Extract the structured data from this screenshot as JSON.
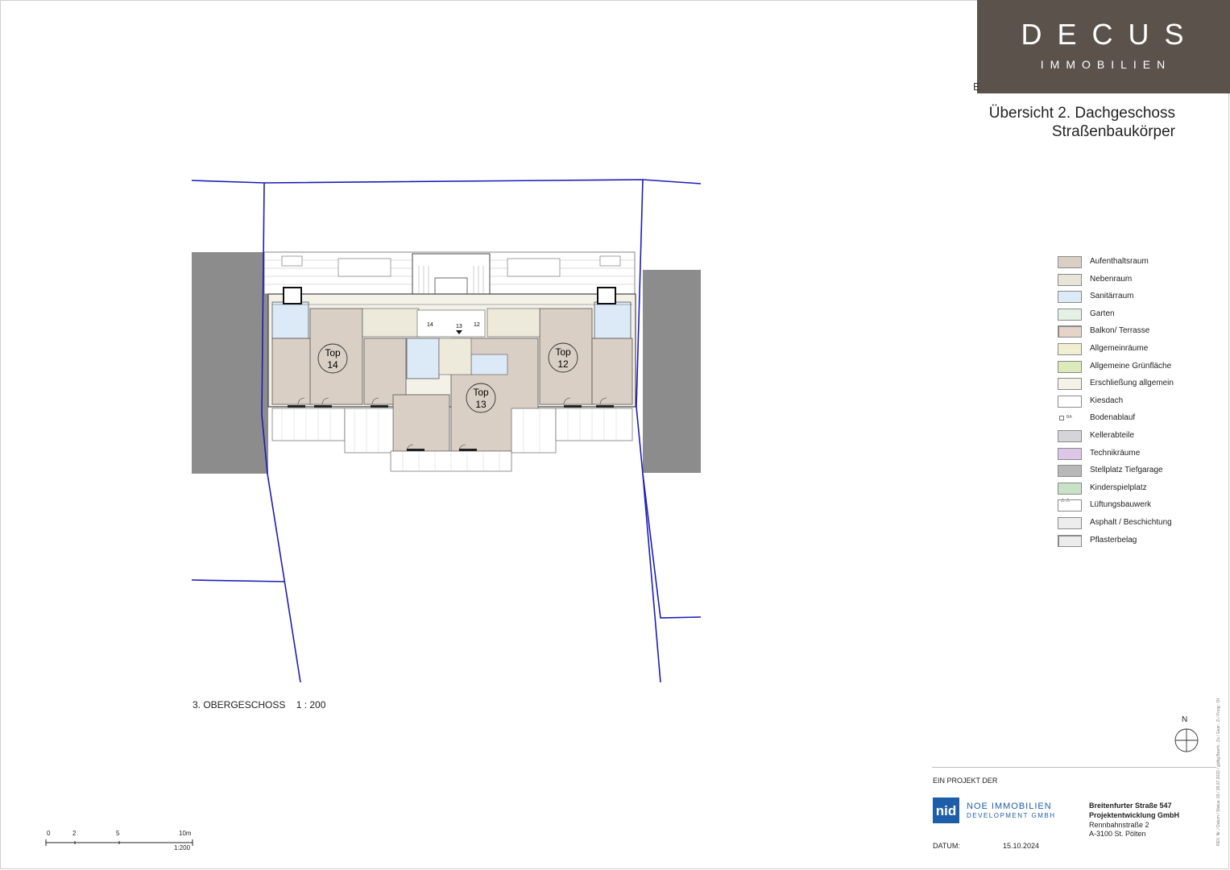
{
  "brand": {
    "name": "DECUS",
    "subtitle": "IMMOBILIEN",
    "bg_color": "#5b524b"
  },
  "header": {
    "title_line1": "Übersicht 2. Dachgeschoss",
    "title_line2": "Straßenbaukörper",
    "left_mark": "E"
  },
  "plan": {
    "label": "3. OBERGESCHOSS    1 : 200",
    "units": [
      {
        "line1": "Top",
        "line2": "14"
      },
      {
        "line1": "Top",
        "line2": "13"
      },
      {
        "line1": "Top",
        "line2": "12"
      }
    ],
    "stair_labels": [
      "14",
      "13",
      "12"
    ],
    "colors": {
      "aufenthalt": "#d9cfc4",
      "nebenraum": "#e9e4d8",
      "sanitaer": "#dce9f7",
      "erschliessung": "#f2f0e6",
      "allgemein": "#eeeadb",
      "neighbor": "#8c8c8c",
      "boundary": "#1d1db8"
    }
  },
  "legend": {
    "items": [
      {
        "label": "Aufenthaltsraum",
        "color": "#d9cfc4"
      },
      {
        "label": "Nebenraum",
        "color": "#e9e4d8"
      },
      {
        "label": "Sanitärraum",
        "color": "#dce9f7"
      },
      {
        "label": "Garten",
        "color": "#e6f1e6"
      },
      {
        "label": "Balkon/ Terrasse",
        "color": "#e4d5c8"
      },
      {
        "label": "Allgemeinräume",
        "color": "#f1eed2"
      },
      {
        "label": "Allgemeine Grünfläche",
        "color": "#dce9b8"
      },
      {
        "label": "Erschließung allgemein",
        "color": "#f3f1e8"
      },
      {
        "label": "Kiesdach",
        "color": "#ffffff"
      },
      {
        "label": "Bodenablauf",
        "color": "#ffffff",
        "mark": "BA"
      },
      {
        "label": "Kellerabteile",
        "color": "#d4d4d9"
      },
      {
        "label": "Technikräume",
        "color": "#dcc8e6"
      },
      {
        "label": "Stellplatz Tiefgarage",
        "color": "#b8b8b8"
      },
      {
        "label": "Kinderspielplatz",
        "color": "#c8e2c8"
      },
      {
        "label": "Lüftungsbauwerk",
        "color": "#ffffff"
      },
      {
        "label": "Asphalt / Beschichtung",
        "color": "#ededed"
      },
      {
        "label": "Pflasterbelag",
        "color": "#ececec"
      }
    ]
  },
  "north": {
    "label": "N"
  },
  "footer": {
    "project_label": "EIN PROJEKT DER",
    "developer_logo": "nid",
    "developer_line1": "NOE IMMOBILIEN",
    "developer_line2": "DEVELOPMENT GMBH",
    "client_line1": "Breitenfurter Straße 547",
    "client_line2": "Projektentwicklung GmbH",
    "client_line3": "Rennbahnstraße 2",
    "client_line4": "A-3100 St. Pölten",
    "date_label": "DATUM:",
    "date_value": "15.10.2024",
    "side_text": "REV. Nr. / Datum / Status: 03 / 28.07.2022 / gültig    Bearb.: Zo / Gepr.: Zi / Freig.: Ot"
  },
  "scale_bar": {
    "ticks": [
      "0",
      "2",
      "5",
      "10m"
    ],
    "ratio": "1:200"
  }
}
